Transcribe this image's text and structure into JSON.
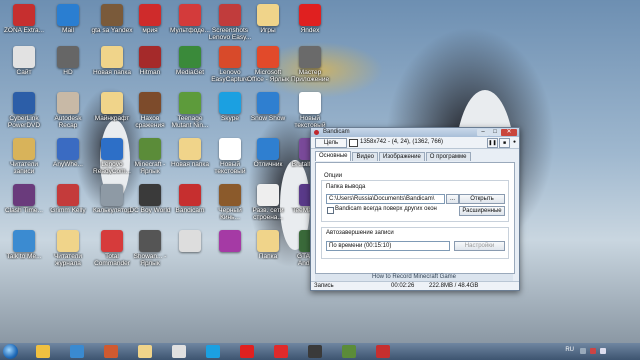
{
  "desktop": {
    "icons": [
      {
        "label": "ZONA Extra...",
        "color": "#c62f2f"
      },
      {
        "label": "Сайт",
        "color": "#e2e2e2"
      },
      {
        "label": "CyberLink PowerDVD",
        "color": "#2c5ea8"
      },
      {
        "label": "Читатели записи",
        "color": "#d8b35a"
      },
      {
        "label": "Clash Time...",
        "color": "#6a3b7c"
      },
      {
        "label": "Talk to Me...",
        "color": "#3b8bd1"
      },
      {
        "label": "Mail",
        "color": "#2a7ed1"
      },
      {
        "label": "HD",
        "color": "#666666"
      },
      {
        "label": "Autodesk Recap",
        "color": "#c8b9a6"
      },
      {
        "label": "AnyWhe...",
        "color": "#3a6bc2"
      },
      {
        "label": "Grimm Kelly",
        "color": "#c43b3b"
      },
      {
        "label": "Читатели журнала",
        "color": "#f0d48a"
      },
      {
        "label": "gta sa Yandex",
        "color": "#7a5a3a"
      },
      {
        "label": "Новая папка",
        "color": "#f0d48a"
      },
      {
        "label": "Майнкрафт",
        "color": "#f0d48a"
      },
      {
        "label": "Lenovo ReadyCom...",
        "color": "#2d6fc7"
      },
      {
        "label": "Калькулятор",
        "color": "#8e9aa5"
      },
      {
        "label": "Total Commander",
        "color": "#d63b3b"
      },
      {
        "label": "мрия",
        "color": "#cf2b2b"
      },
      {
        "label": "Hitman",
        "color": "#a52a2a"
      },
      {
        "label": "Нахов сражения",
        "color": "#7d4b2b"
      },
      {
        "label": "Minecraft - Ярлык",
        "color": "#5b8c39"
      },
      {
        "label": "DC Boy World",
        "color": "#3a3a3a"
      },
      {
        "label": "Showan... - Ярлык",
        "color": "#555555"
      },
      {
        "label": "Мультфоде...",
        "color": "#d33b3b"
      },
      {
        "label": "MediaGet",
        "color": "#3a8a3a"
      },
      {
        "label": "Teenage Mutant Nin...",
        "color": "#5d9b3b"
      },
      {
        "label": "Новая папка",
        "color": "#f0d48a"
      },
      {
        "label": "Bandicam",
        "color": "#c62f2f"
      },
      {
        "label": "",
        "color": "#dddddd"
      },
      {
        "label": "Screenshots Lenovo Easy...",
        "color": "#c13c3c"
      },
      {
        "label": "Lenovo EasyCapture",
        "color": "#d84a2a"
      },
      {
        "label": "Skype",
        "color": "#1ba0e1"
      },
      {
        "label": "Новый текстовый",
        "color": "#ffffff"
      },
      {
        "label": "Черный Кинь...",
        "color": "#8b5a2b"
      },
      {
        "label": "",
        "color": "#a53aa5"
      },
      {
        "label": "Игры",
        "color": "#f0d48a"
      },
      {
        "label": "Microsoft Office - Ярлык",
        "color": "#e24a2a"
      },
      {
        "label": "Snow Show",
        "color": "#2f7fd0"
      },
      {
        "label": "Отличник",
        "color": "#2f7fd0"
      },
      {
        "label": "Разв. сети строена...",
        "color": "#eeeeee"
      },
      {
        "label": "Папка",
        "color": "#f0d48a"
      },
      {
        "label": "Яndex",
        "color": "#e02020"
      },
      {
        "label": "Мастер Приложение",
        "color": "#6a6a6a"
      },
      {
        "label": "Новый текстовый",
        "color": "#ffffff"
      },
      {
        "label": "Brutalfy1.5...",
        "color": "#7a4a9a"
      },
      {
        "label": "TeeMalmo...",
        "color": "#5a3a8a"
      },
      {
        "label": "GTA San Andreas",
        "color": "#3a6a3a"
      }
    ]
  },
  "bandicam": {
    "title": "Bandicam",
    "min": "–",
    "max": "□",
    "close": "✕",
    "toolbar": {
      "target_label": "Цель",
      "coords": "1358x742 - (4, 24), (1362, 766)",
      "pause": "❚❚",
      "stop": "■",
      "rec": "●"
    },
    "tabs": [
      "Основные",
      "Видео",
      "Изображение",
      "О программе"
    ],
    "options_group": "Опции",
    "output_folder_label": "Папка вывода",
    "output_folder_value": "C:\\Users\\Russia\\Documents\\Bandicam\\",
    "browse_button": "...",
    "open_button": "Открыть",
    "always_on_top_label": "Bandicam всегда поверх других окон",
    "advanced_button": "Расширенные",
    "autostop_group": "Автозавершение записи",
    "autostop_value": "По времени (00:15:10)",
    "settings_button": "Настройки",
    "banner": "How to Record Minecraft Game",
    "status": {
      "label": "Запись",
      "time": "00:02:26",
      "size": "222.8MB / 48.4GB"
    }
  },
  "taskbar": {
    "language": "RU",
    "time": "",
    "pinned_colors": [
      "#f0c040",
      "#3a8ad0",
      "#d05a30",
      "#f0d48a",
      "#e0e0e0",
      "#1ba0e1",
      "#e02020",
      "#e02a2a",
      "#3a3a3a",
      "#5b8c39",
      "#c62f2f"
    ]
  },
  "colors": {
    "accent": "#c62f2f",
    "window_bg": "#e8eef5"
  }
}
